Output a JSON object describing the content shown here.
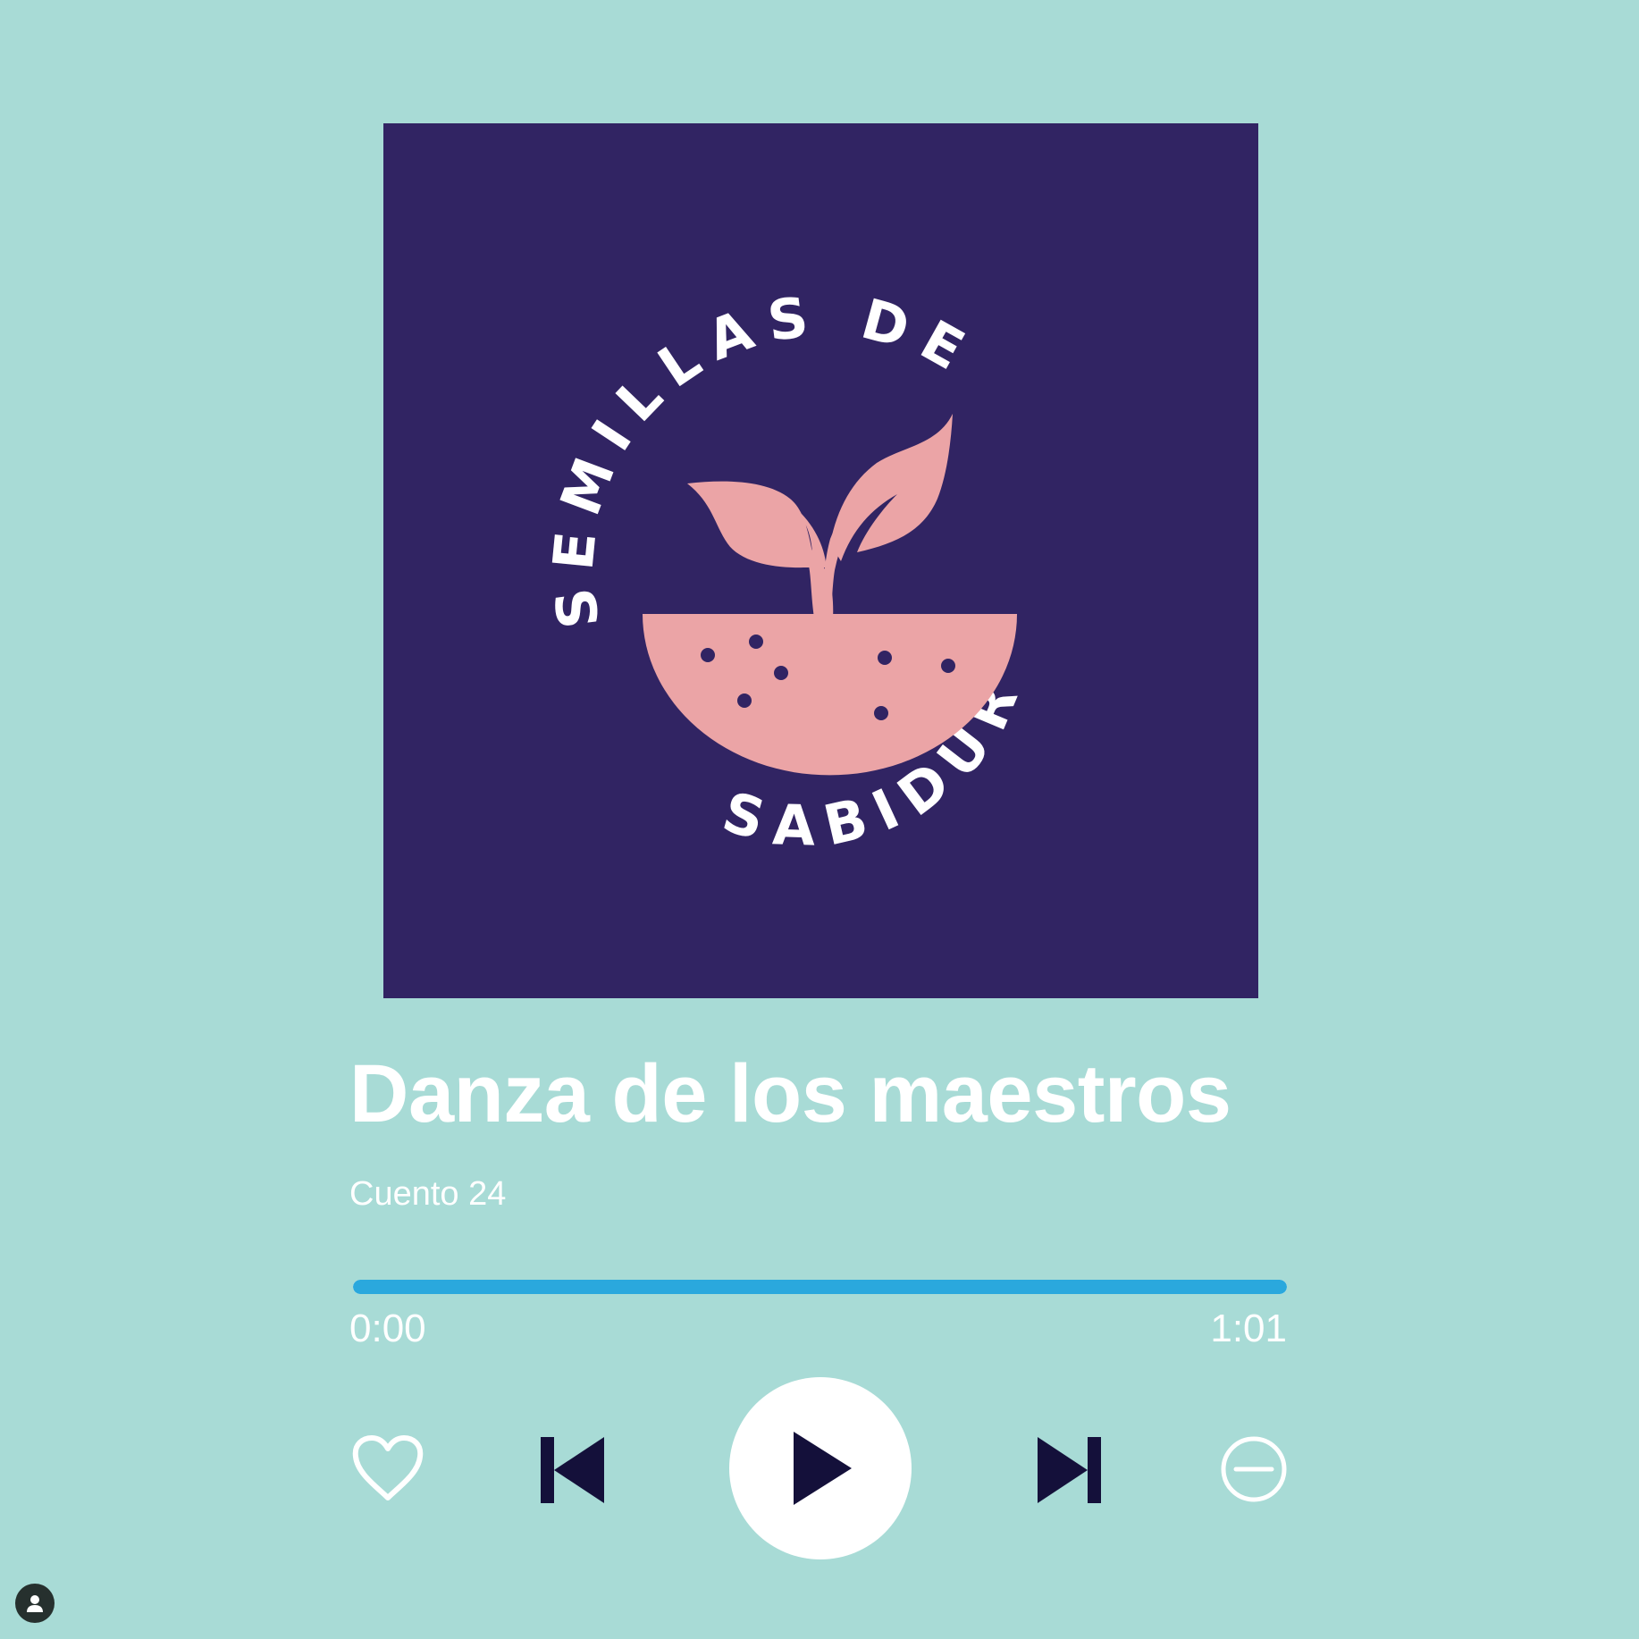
{
  "cover": {
    "arc_top": "SEMILLAS DE",
    "arc_bottom": "SABIDURIA",
    "background_color": "#312463",
    "accent_color": "#eba4a6"
  },
  "track": {
    "title": "Danza de los maestros",
    "subtitle": "Cuento 24"
  },
  "progress": {
    "current_time": "0:00",
    "total_time": "1:01",
    "fraction": 1.0,
    "fill_color": "#2aa8dd"
  },
  "controls": {
    "like": "heart-icon",
    "previous": "skip-previous-icon",
    "play": "play-icon",
    "next": "skip-next-icon",
    "remove": "minus-circle-icon"
  },
  "colors": {
    "background": "#a8dbd6",
    "icon_dark": "#14103a",
    "text": "#ffffff"
  }
}
